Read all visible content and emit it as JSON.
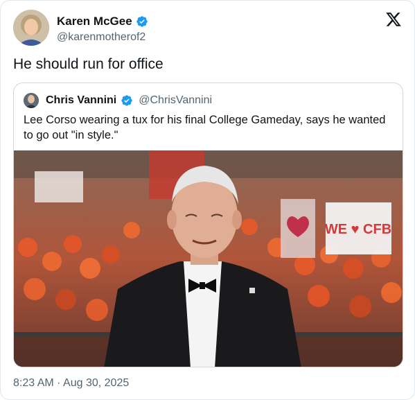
{
  "author": {
    "display_name": "Karen McGee",
    "handle": "@karenmotherof2",
    "verified": true
  },
  "tweet": {
    "text": "He should run for office",
    "timestamp": "8:23 AM · Aug 30, 2025"
  },
  "quoted_tweet": {
    "display_name": "Chris Vannini",
    "handle": "@ChrisVannini",
    "verified": true,
    "text": "Lee Corso wearing a tux for his final College Gameday, says he wanted to go out \"in style.\""
  },
  "media": {
    "sign_text": "WE ♥ CFB"
  },
  "icons": {
    "verified": "verified-badge-icon",
    "brand": "x-logo-icon"
  },
  "colors": {
    "verified_blue": "#1d9bf0",
    "secondary_text": "#536471",
    "border": "#cfd9de"
  }
}
